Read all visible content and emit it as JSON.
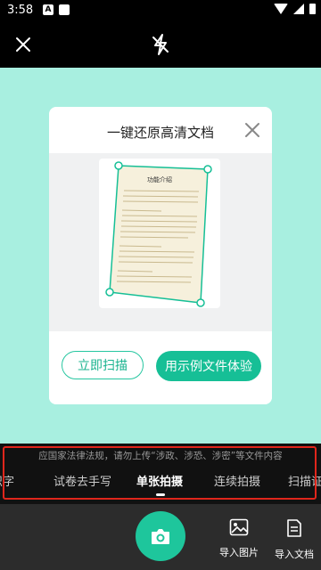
{
  "statusbar": {
    "time": "3:58",
    "app_icon_letter": "A"
  },
  "modal": {
    "title": "一键还原高清文档",
    "scan_button": "立即扫描",
    "sample_button": "用示例文件体验",
    "preview_title": "功能介绍"
  },
  "notice": "应国家法律法规，请勿上传“涉政、涉恐、涉密”等文件内容",
  "modes": [
    "识字",
    "试卷去手写",
    "单张拍摄",
    "连续拍摄",
    "扫描证"
  ],
  "active_mode": "单张拍摄",
  "bottom": {
    "import_image": "导入图片",
    "import_doc": "导入文档"
  },
  "colors": {
    "accent": "#16bf96",
    "camera_bg": "#a8efe0",
    "highlight": "#e0261c"
  },
  "icons": {
    "close": "close-icon",
    "flash": "flash-off-icon",
    "shutter": "camera-icon",
    "image": "image-icon",
    "document": "document-icon"
  }
}
